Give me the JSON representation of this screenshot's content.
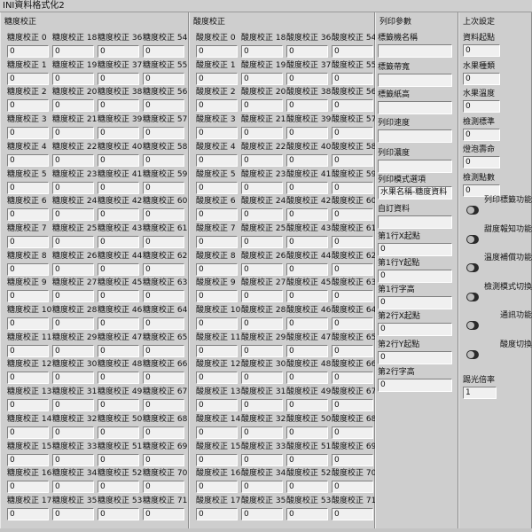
{
  "window": {
    "title": "INI資料格式化2"
  },
  "sugar": {
    "title": "糖度校正",
    "label_prefix": "糖度校正",
    "default_value": "0"
  },
  "acid": {
    "title": "酸度校正",
    "label_prefix": "酸度校正",
    "default_value": "0"
  },
  "print": {
    "title": "列印參數",
    "fields": [
      {
        "label": "標籤機名稱",
        "value": ""
      },
      {
        "label": "標籤帶寬",
        "value": ""
      },
      {
        "label": "標籤紙高",
        "value": ""
      },
      {
        "label": "列印速度",
        "value": ""
      },
      {
        "label": "列印濃度",
        "value": ""
      },
      {
        "label": "列印模式選項",
        "value": "水果名稱-糖度資料"
      },
      {
        "label": "自訂資料",
        "value": ""
      },
      {
        "label": "第1行X起點",
        "value": "0"
      },
      {
        "label": "第1行Y起點",
        "value": "0"
      },
      {
        "label": "第1行字高",
        "value": "0"
      },
      {
        "label": "第2行X起點",
        "value": "0"
      },
      {
        "label": "第2行Y起點",
        "value": "0"
      },
      {
        "label": "第2行字高",
        "value": "0"
      }
    ]
  },
  "last": {
    "title": "上次設定",
    "fields": [
      {
        "label": "資料起點",
        "value": "0"
      },
      {
        "label": "水果種類",
        "value": "0"
      },
      {
        "label": "水果溫度",
        "value": "0"
      },
      {
        "label": "檢測標準",
        "value": "0"
      },
      {
        "label": "燈泡壽命",
        "value": "0"
      },
      {
        "label": "檢測點數",
        "value": "0"
      }
    ],
    "toggles": [
      {
        "label": "列印標籤功能"
      },
      {
        "label": "甜度報知功能"
      },
      {
        "label": "溫度補償功能"
      },
      {
        "label": "檢測模式切換"
      },
      {
        "label": "通訊功能"
      },
      {
        "label": "酸度切換"
      }
    ],
    "gain": {
      "label": "踢光倍率",
      "value": "1"
    }
  }
}
